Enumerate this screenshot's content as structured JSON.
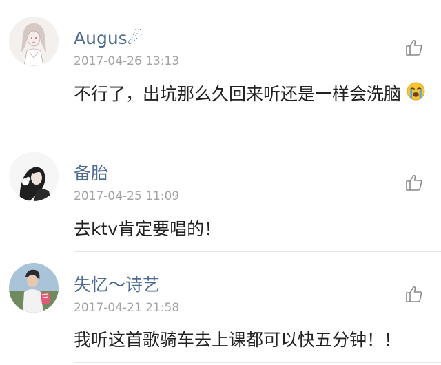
{
  "comments": [
    {
      "username": "Augus☄",
      "timestamp": "2017-04-26 13:13",
      "text": "不行了，出坑那么久回来听还是一样会洗脑",
      "emoji": "loudly-crying-face-icon",
      "avatar": "sketch-girl-avatar"
    },
    {
      "username": "备胎",
      "timestamp": "2017-04-25 11:09",
      "text": "去ktv肯定要唱的！",
      "avatar": "dark-hair-girl-avatar"
    },
    {
      "username": "失忆～诗艺",
      "timestamp": "2017-04-21 21:58",
      "text": "我听这首歌骑车去上课都可以快五分钟！！",
      "avatar": "photo-person-avatar"
    }
  ],
  "colors": {
    "username": "#4d6b93",
    "timestamp": "#a3a3a3",
    "text": "#222222",
    "divider": "#e6e6e6",
    "like_icon": "#888888"
  }
}
